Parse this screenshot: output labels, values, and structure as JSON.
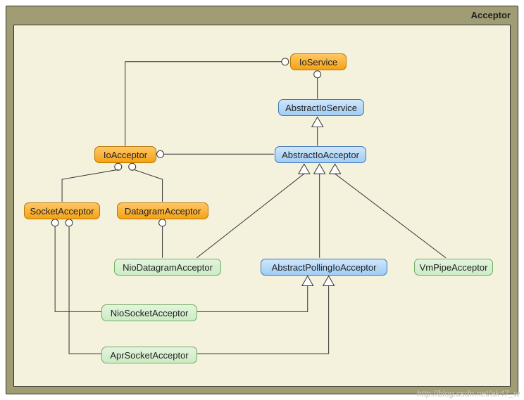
{
  "frame": {
    "title": "Acceptor"
  },
  "nodes": {
    "ioService": {
      "label": "IoService",
      "kind": "interface"
    },
    "abstractIoService": {
      "label": "AbstractIoService",
      "kind": "abstract"
    },
    "abstractIoAcceptor": {
      "label": "AbstractIoAcceptor",
      "kind": "abstract"
    },
    "ioAcceptor": {
      "label": "IoAcceptor",
      "kind": "interface"
    },
    "socketAcceptor": {
      "label": "SocketAcceptor",
      "kind": "interface"
    },
    "datagramAcceptor": {
      "label": "DatagramAcceptor",
      "kind": "interface"
    },
    "nioDatagramAcceptor": {
      "label": "NioDatagramAcceptor",
      "kind": "class"
    },
    "abstractPollingIoAcceptor": {
      "label": "AbstractPollingIoAcceptor",
      "kind": "abstract"
    },
    "vmPipeAcceptor": {
      "label": "VmPipeAcceptor",
      "kind": "class"
    },
    "nioSocketAcceptor": {
      "label": "NioSocketAcceptor",
      "kind": "class"
    },
    "aprSocketAcceptor": {
      "label": "AprSocketAcceptor",
      "kind": "class"
    }
  },
  "edges": [
    {
      "kind": "realization",
      "from": "abstractIoService",
      "to": "ioService"
    },
    {
      "kind": "realization",
      "from": "ioAcceptor",
      "to": "ioService"
    },
    {
      "kind": "generalization",
      "from": "abstractIoAcceptor",
      "to": "abstractIoService"
    },
    {
      "kind": "realization",
      "from": "abstractIoAcceptor",
      "to": "ioAcceptor"
    },
    {
      "kind": "realization",
      "from": "socketAcceptor",
      "to": "ioAcceptor"
    },
    {
      "kind": "realization",
      "from": "datagramAcceptor",
      "to": "ioAcceptor"
    },
    {
      "kind": "generalization",
      "from": "nioDatagramAcceptor",
      "to": "abstractIoAcceptor"
    },
    {
      "kind": "realization",
      "from": "nioDatagramAcceptor",
      "to": "datagramAcceptor"
    },
    {
      "kind": "generalization",
      "from": "abstractPollingIoAcceptor",
      "to": "abstractIoAcceptor"
    },
    {
      "kind": "generalization",
      "from": "vmPipeAcceptor",
      "to": "abstractIoAcceptor"
    },
    {
      "kind": "generalization",
      "from": "nioSocketAcceptor",
      "to": "abstractPollingIoAcceptor"
    },
    {
      "kind": "realization",
      "from": "nioSocketAcceptor",
      "to": "socketAcceptor"
    },
    {
      "kind": "generalization",
      "from": "aprSocketAcceptor",
      "to": "abstractPollingIoAcceptor"
    },
    {
      "kind": "realization",
      "from": "aprSocketAcceptor",
      "to": "socketAcceptor"
    }
  ],
  "watermark": "http://blog.csdn.net/ak47_w"
}
